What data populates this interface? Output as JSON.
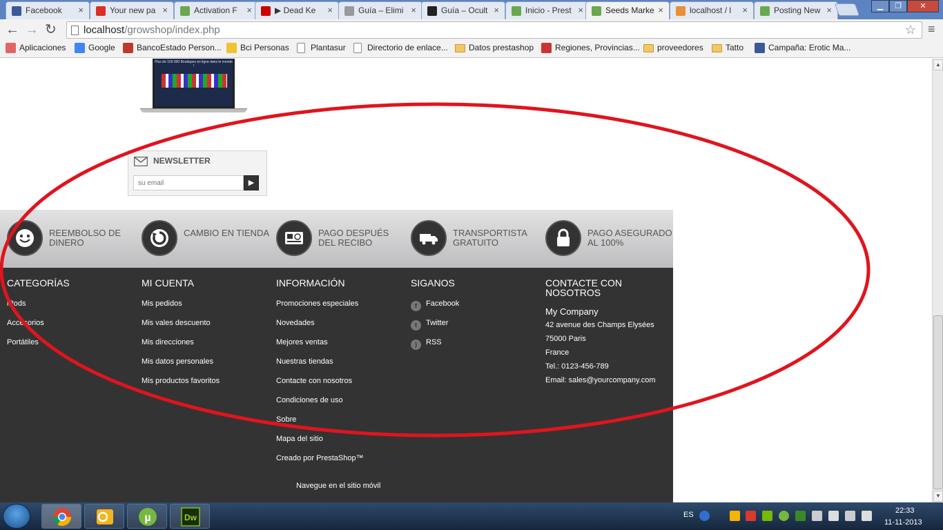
{
  "browser": {
    "tabs": [
      {
        "label": "Facebook",
        "icon": "facebook-icon",
        "color": "#3b5998"
      },
      {
        "label": "Your new pa",
        "icon": "gmail-icon",
        "color": "#d93025"
      },
      {
        "label": "Activation F",
        "icon": "prestashop-icon",
        "color": "#6aa84f"
      },
      {
        "label": "▶ Dead Ke",
        "icon": "youtube-icon",
        "color": "#cc0000"
      },
      {
        "label": "Guía – Elimi",
        "icon": "page-icon",
        "color": "#999999"
      },
      {
        "label": "Guía – Ocult",
        "icon": "v-icon",
        "color": "#222222"
      },
      {
        "label": "Inicio - Prest",
        "icon": "prestashop-icon",
        "color": "#6aa84f"
      },
      {
        "label": "Seeds Marke",
        "icon": "prestashop-icon",
        "color": "#6aa84f"
      },
      {
        "label": "localhost / l",
        "icon": "phpmyadmin-icon",
        "color": "#e69138"
      },
      {
        "label": "Posting New",
        "icon": "prestashop-icon",
        "color": "#6aa84f"
      }
    ],
    "active_tab": "Seeds Marke",
    "url_host": "localhost",
    "url_path": "/growshop/index.php",
    "bookmarks": [
      {
        "label": "Aplicaciones",
        "icon": "apps-grid-icon"
      },
      {
        "label": "Google",
        "icon": "google-icon"
      },
      {
        "label": "BancoEstado Person...",
        "icon": "bancoestado-icon"
      },
      {
        "label": "Bci Personas",
        "icon": "bci-icon"
      },
      {
        "label": "Plantasur",
        "icon": "page-icon"
      },
      {
        "label": "Directorio de enlace...",
        "icon": "page-icon"
      },
      {
        "label": "Datos prestashop",
        "icon": "folder-icon"
      },
      {
        "label": "Regiones, Provincias...",
        "icon": "flag-icon"
      },
      {
        "label": "proveedores",
        "icon": "folder-icon"
      },
      {
        "label": "Tatto",
        "icon": "folder-icon"
      },
      {
        "label": "Campaña: Erotic Ma...",
        "icon": "facebook-icon"
      }
    ]
  },
  "page": {
    "banner_text": "Plus de 100 000 Boutiques en ligne dans le monde !",
    "newsletter": {
      "title": "NEWSLETTER",
      "placeholder": "su email"
    },
    "reassurance": [
      {
        "label": "REEMBOLSO DE DINERO",
        "icon": "smiley-icon"
      },
      {
        "label": "CAMBIO EN TIENDA",
        "icon": "refresh-icon"
      },
      {
        "label": "PAGO DESPUÉS DEL RECIBO",
        "icon": "credit-card-icon"
      },
      {
        "label": "TRANSPORTISTA GRATUITO",
        "icon": "truck-icon"
      },
      {
        "label": "PAGO ASEGURADO AL 100%",
        "icon": "lock-icon"
      }
    ],
    "footer": {
      "categories": {
        "title": "CATEGORÍAS",
        "items": [
          "iPods",
          "Accesorios",
          "Portátiles"
        ]
      },
      "account": {
        "title": "MI CUENTA",
        "items": [
          "Mis pedidos",
          "Mis vales descuento",
          "Mis direcciones",
          "Mis datos personales",
          "Mis productos favoritos"
        ]
      },
      "info": {
        "title": "INFORMACIÓN",
        "items": [
          "Promociones especiales",
          "Novedades",
          "Mejores ventas",
          "Nuestras tiendas",
          "Contacte con nosotros",
          "Condiciones de uso",
          "Sobre",
          "Mapa del sitio",
          "Creado por PrestaShop™"
        ]
      },
      "follow": {
        "title": "SIGANOS",
        "items": [
          "Facebook",
          "Twitter",
          "RSS"
        ]
      },
      "contact": {
        "title": "CONTACTE CON NOSOTROS",
        "company": "My Company",
        "lines": [
          "42 avenue des Champs Elysées",
          "75000 Paris",
          "France",
          "Tel.: 0123-456-789",
          "Email: sales@yourcompany.com"
        ]
      },
      "mobile_link": "Navegue en el sitio móvil"
    },
    "annotation_color": "#e0141e"
  },
  "taskbar": {
    "apps": [
      "chrome-icon",
      "outlook-icon",
      "utorrent-icon",
      "dreamweaver-icon"
    ],
    "language": "ES",
    "time": "22:33",
    "date": "11-11-2013"
  }
}
